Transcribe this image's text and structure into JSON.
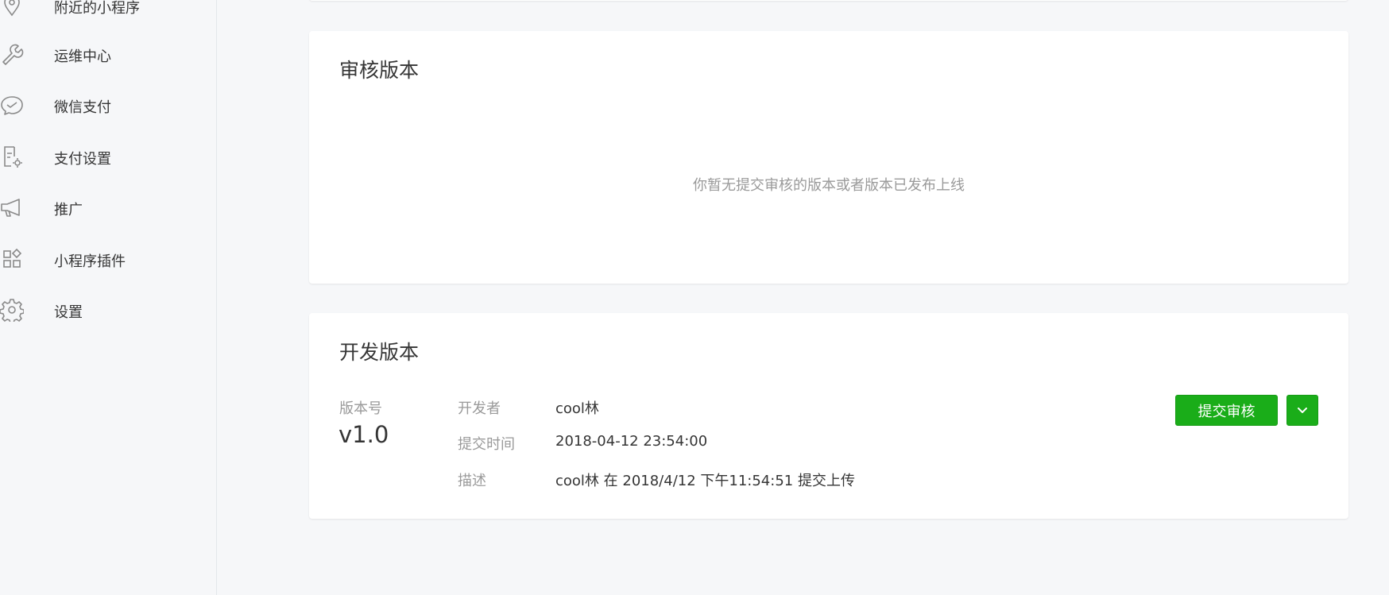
{
  "sidebar": {
    "items": [
      {
        "label": "附近的小程序",
        "icon": "location-pin-icon"
      },
      {
        "label": "运维中心",
        "icon": "wrench-icon"
      },
      {
        "label": "微信支付",
        "icon": "wechat-pay-icon"
      },
      {
        "label": "支付设置",
        "icon": "payment-settings-icon"
      },
      {
        "label": "推广",
        "icon": "megaphone-icon"
      },
      {
        "label": "小程序插件",
        "icon": "plugin-grid-icon"
      },
      {
        "label": "设置",
        "icon": "gear-icon"
      }
    ]
  },
  "review": {
    "title": "审核版本",
    "empty_text": "你暂无提交审核的版本或者版本已发布上线"
  },
  "dev": {
    "title": "开发版本",
    "version_label": "版本号",
    "version": "v1.0",
    "developer_label": "开发者",
    "developer": "cool林",
    "submit_time_label": "提交时间",
    "submit_time": "2018-04-12 23:54:00",
    "desc_label": "描述",
    "desc": "cool林 在 2018/4/12 下午11:54:51 提交上传",
    "submit_button": "提交审核"
  },
  "colors": {
    "primary": "#1aad19",
    "text": "#353535",
    "muted": "#9a9a9a",
    "background": "#f6f7f9"
  }
}
